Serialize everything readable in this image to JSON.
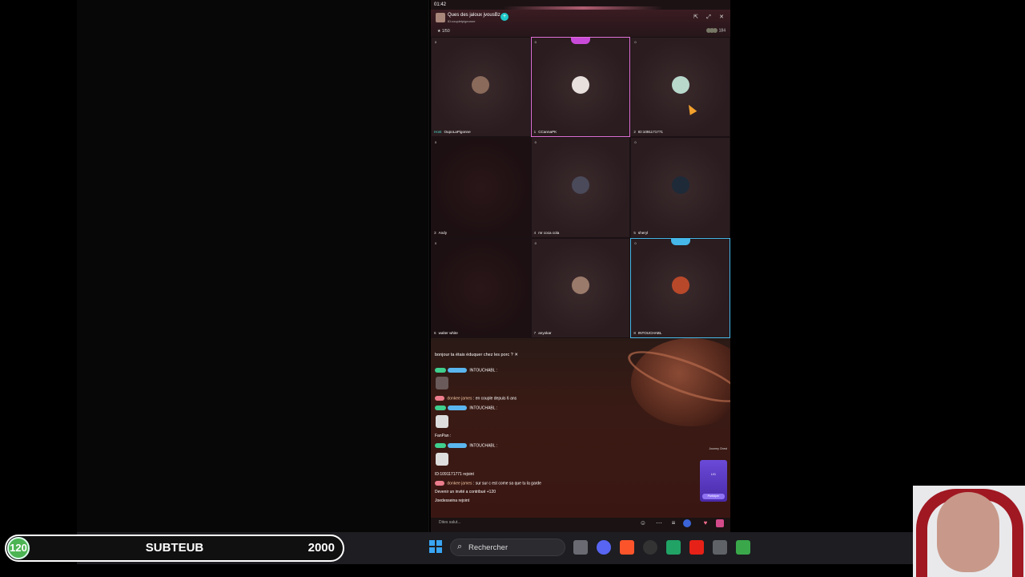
{
  "phone": {
    "status_time": "01:42",
    "room": {
      "title": "Ques des jaloux jvousBz",
      "id_line": "ID:coupletpigeonne",
      "meta": "1/50",
      "viewers": "184"
    },
    "seats": [
      {
        "index_label": "Host",
        "name": "OupoLaPigonne",
        "score": "0",
        "style": "normal"
      },
      {
        "index_label": "1",
        "name": "CCannaPK",
        "score": "0",
        "style": "pink"
      },
      {
        "index_label": "2",
        "name": "ID:1091171771",
        "score": "0",
        "style": "normal"
      },
      {
        "index_label": "3",
        "name": "Andy",
        "score": "0",
        "style": "dark"
      },
      {
        "index_label": "4",
        "name": "mr coca cola",
        "score": "0",
        "style": "normal"
      },
      {
        "index_label": "5",
        "name": "sheryl",
        "score": "0",
        "style": "normal"
      },
      {
        "index_label": "6",
        "name": "walter white",
        "score": "0",
        "style": "dark"
      },
      {
        "index_label": "7",
        "name": "anyokar",
        "score": "0",
        "style": "normal"
      },
      {
        "index_label": "8",
        "name": "INTOUCHABL",
        "score": "0",
        "style": "blue"
      }
    ],
    "chat": {
      "announce": "bonjour ta étais éduquer chez les porc ? ✕",
      "messages": [
        {
          "user": "INTOUCHABL :",
          "text": ""
        },
        {
          "user": "donkee james",
          "text": ": en couple depuis 6 ans"
        },
        {
          "user": "INTOUCHABL :",
          "text": ""
        },
        {
          "user": "FanPan :",
          "text": ""
        },
        {
          "user": "INTOUCHABL :",
          "text": ""
        },
        {
          "user": "",
          "text": "ID:1091171771 rejoint"
        },
        {
          "user": "donkee james",
          "text": ": sur sur c est come sa que tu la garde"
        },
        {
          "user": "",
          "text": "Devenir un invité a contribué +120"
        },
        {
          "user": "",
          "text": "Joedesseina rejoint"
        }
      ],
      "mini_card_top": "Journey Chest",
      "mini_card_label": "LV1",
      "mini_card_button": "Participer"
    },
    "input_placeholder": "Dites salut..."
  },
  "subbar": {
    "current": "120",
    "label": "SUBTEUB",
    "goal": "2000",
    "progress": 0.06
  },
  "taskbar": {
    "search_label": "Rechercher",
    "apps": [
      "file-explorer-icon",
      "discord-icon",
      "brave-icon",
      "clock-icon",
      "spreadsheet-icon",
      "youtube-icon",
      "settings-icon",
      "bluestacks-icon"
    ]
  },
  "colors": {
    "progress_green": "#4cb453",
    "accent_pink": "#e06fd6",
    "accent_blue": "#45b7e8"
  }
}
